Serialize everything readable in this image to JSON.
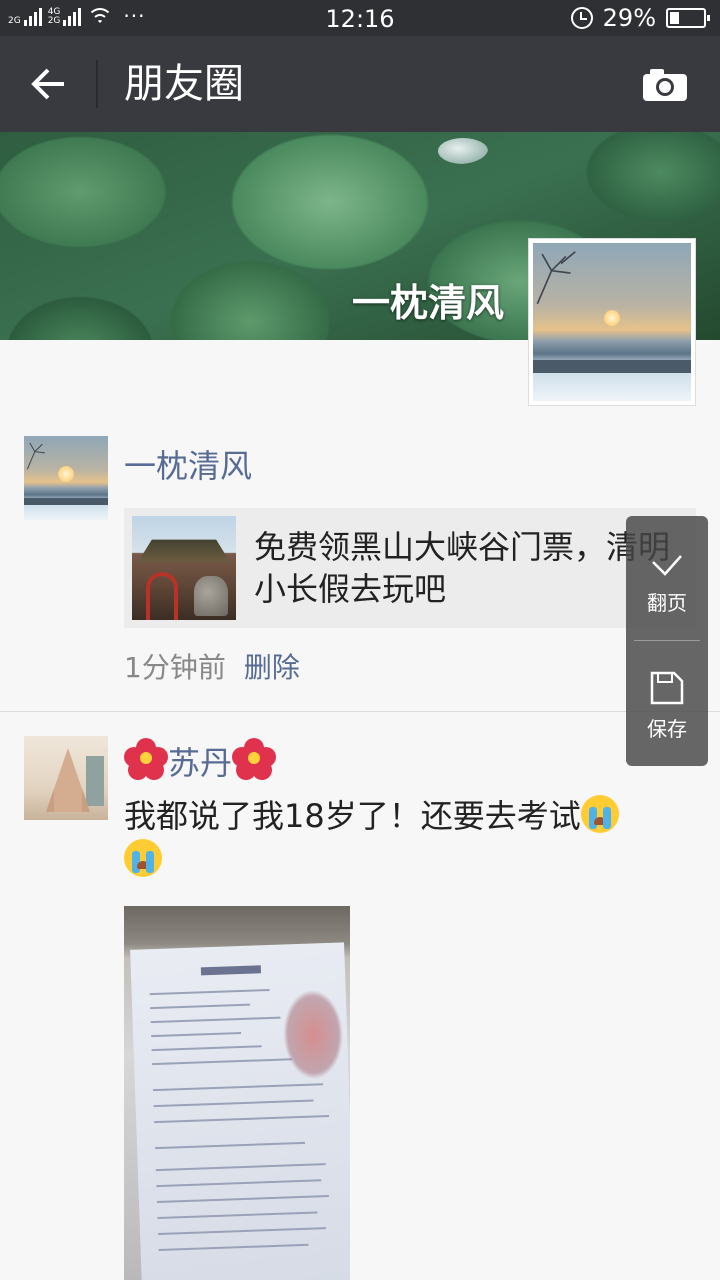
{
  "status_bar": {
    "net1": "2G",
    "net2": "4G",
    "net3": "2G",
    "more": "···",
    "time": "12:16",
    "battery_text": "29%",
    "battery_level": 0.29
  },
  "header": {
    "title": "朋友圈"
  },
  "cover": {
    "name": "一枕清风"
  },
  "posts": [
    {
      "name": "一枕清风",
      "link_text": "免费领黑山大峡谷门票，清明小长假去玩吧",
      "time": "1分钟前",
      "delete_label": "删除"
    },
    {
      "name": "苏丹",
      "text": "我都说了我18岁了！还要去考试"
    }
  ],
  "float_panel": {
    "translate_label": "翻页",
    "save_label": "保存"
  },
  "colors": {
    "status_bg": "#2e3033",
    "titlebar_bg": "#393a3f",
    "name_blue": "#576b95",
    "page_bg": "#f7f7f7"
  }
}
